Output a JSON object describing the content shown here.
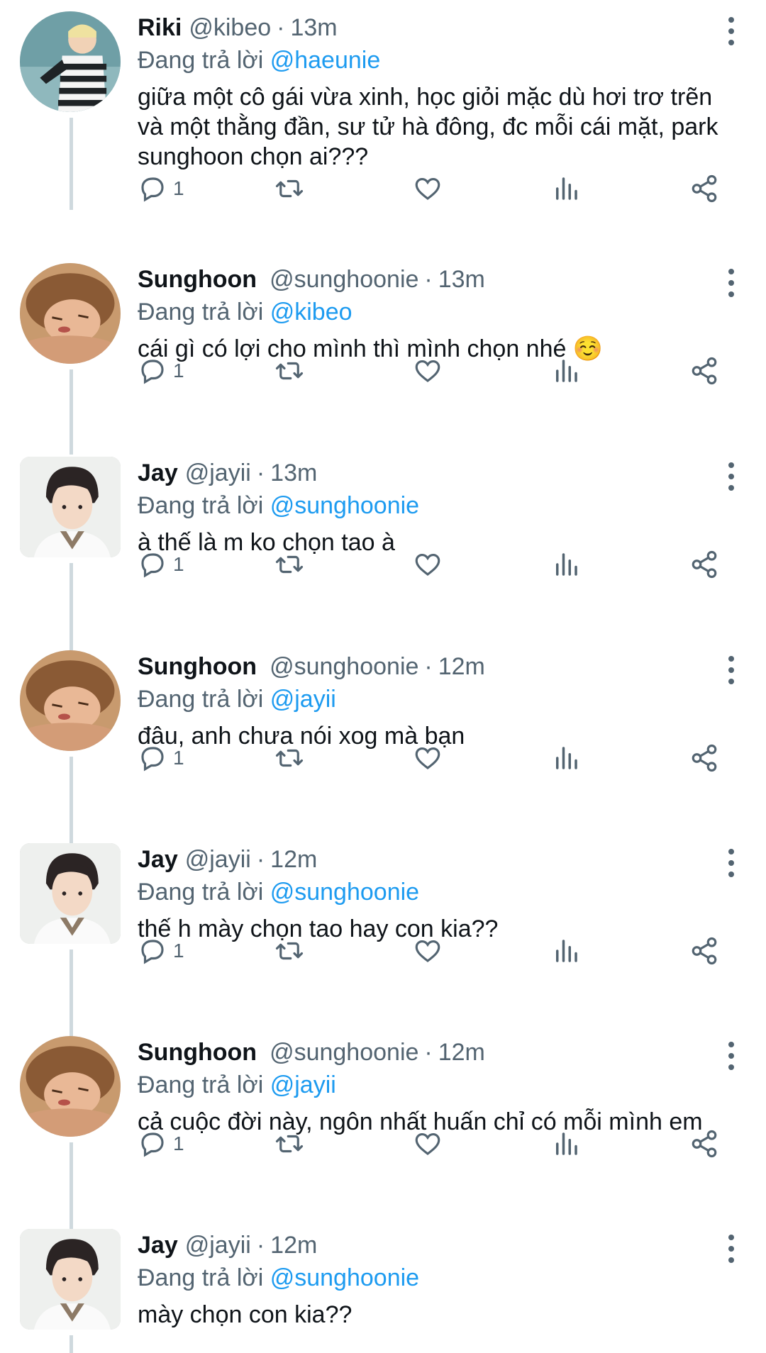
{
  "ui": {
    "reply_prefix": "Đang trả lời",
    "separator": "·"
  },
  "colors": {
    "text": "#0f1419",
    "secondary": "#536471",
    "accent": "#1d9bf0",
    "thread_line": "#cfd9de"
  },
  "tweets": [
    {
      "name": "Riki",
      "handle": "@kibeo",
      "time": "13m",
      "reply_to": "@haeunie",
      "text": "giữa một cô gái vừa xinh, học giỏi mặc dù hơi trơ trẽn\nvà một thằng đần, sư tử hà đông, đc mỗi cái mặt, park\nsunghoon chọn ai???",
      "reply_count": "1",
      "avatar": "riki-avatar"
    },
    {
      "name": "Sunghoon",
      "handle": "@sunghoonie",
      "time": "13m",
      "reply_to": "@kibeo",
      "text": "cái gì có lợi cho mình thì mình chọn nhé ☺️",
      "reply_count": "1",
      "avatar": "sunghoon-avatar"
    },
    {
      "name": "Jay",
      "handle": "@jayii",
      "time": "13m",
      "reply_to": "@sunghoonie",
      "text": "à thế là m ko chọn tao à",
      "reply_count": "1",
      "avatar": "jay-avatar"
    },
    {
      "name": "Sunghoon",
      "handle": "@sunghoonie",
      "time": "12m",
      "reply_to": "@jayii",
      "text": "đâu, anh chưa nói xog mà bạn",
      "reply_count": "1",
      "avatar": "sunghoon-avatar"
    },
    {
      "name": "Jay",
      "handle": "@jayii",
      "time": "12m",
      "reply_to": "@sunghoonie",
      "text": "thế h mày chọn tao hay con kia??",
      "reply_count": "1",
      "avatar": "jay-avatar"
    },
    {
      "name": "Sunghoon",
      "handle": "@sunghoonie",
      "time": "12m",
      "reply_to": "@jayii",
      "text": "cả cuộc đời này, ngôn nhất huấn chỉ có mỗi mình em",
      "reply_count": "1",
      "avatar": "sunghoon-avatar"
    },
    {
      "name": "Jay",
      "handle": "@jayii",
      "time": "12m",
      "reply_to": "@sunghoonie",
      "text": "mày chọn con kia??",
      "reply_count": "",
      "avatar": "jay-avatar"
    }
  ]
}
